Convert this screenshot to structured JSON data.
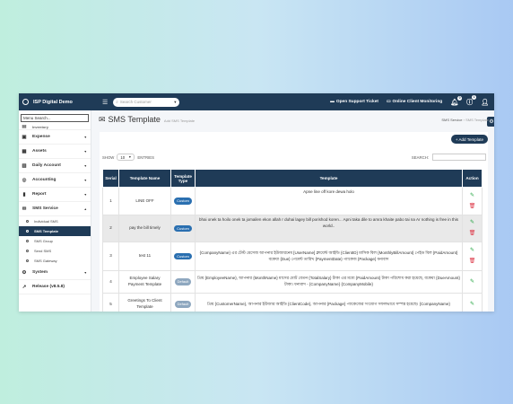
{
  "topbar": {
    "brand": "ISP Digital Demo",
    "search_placeholder": "Search Customer",
    "support_label": "Open Support Ticket",
    "monitoring_label": "Online Client Monitoring",
    "notif_count": "0",
    "info_count": "1"
  },
  "sidebar": {
    "search_placeholder": "Menu Search...",
    "top_partial": "Inventory",
    "items": [
      {
        "label": "Expense",
        "icon": "money-icon"
      },
      {
        "label": "Assets",
        "icon": "box-icon"
      },
      {
        "label": "Daily Account",
        "icon": "calendar-icon"
      },
      {
        "label": "Accounting",
        "icon": "calculator-icon"
      },
      {
        "label": "Report",
        "icon": "document-icon"
      },
      {
        "label": "SMS Service",
        "icon": "envelope-icon"
      }
    ],
    "sms_sub": [
      "Individual SMS",
      "SMS Template",
      "SMS Group",
      "Send SMS",
      "SMS Gateway"
    ],
    "system_label": "System",
    "release_label": "Release (v8.5.8)"
  },
  "header": {
    "title": "SMS Template",
    "add_link": "Add SMS Template",
    "crumb_parent": "SMS Service",
    "crumb_current": "SMS Template"
  },
  "toolbar": {
    "add_button": "+ Add Template",
    "show_label": "SHOW",
    "entries_value": "10",
    "entries_label": "ENTRIES",
    "search_label": "SEARCH:"
  },
  "table": {
    "headers": [
      "Serial",
      "Template Name",
      "Template Type",
      "Template",
      "Action"
    ],
    "rows": [
      {
        "serial": "1",
        "name": "LINE OFF",
        "type": "Custom",
        "template": "Apne line off kore dewa holo"
      },
      {
        "serial": "2",
        "name": "pay the bill timely",
        "type": "Custom",
        "template": "bhai onek ta hoilo onek ta jomailen ekon allah r duhai lagey bill porishod koren... Apni taka dile to amra khaite pabo tai na Ar nothing is free in this world.."
      },
      {
        "serial": "3",
        "name": "test 11",
        "type": "Custom",
        "template": "{CompanyName} এর টেস্ট মেসেজ আপনার ইউজারনেম [UserName] ক্লায়েন্ট আইডি {ClientID} মাসিক বিল {MonthlyBillAmount} পেইড বিল {PaidAmount} বকেয়া {Due} পেমেন্ট তারিখ {PaymentDate} প্যাকেজ {Package} ধন্যবাদ"
      },
      {
        "serial": "4",
        "name": "Employee Salary Payment Template",
        "type": "Default",
        "template": "প্রিয় {EmployeeName}, আপনার {MonthName} মাসের মোট বেতন {TotalSalary} টাকা এর মধ্যে {PaidAmount} টাকা পরিশোধ করা হয়েছে, বকেয়া {DueAmount} টাকা। ধন্যবাদ - {CompanyName} {CompanyMobile}"
      },
      {
        "serial": "5",
        "name": "Greetings To Client Template",
        "type": "Default",
        "template": "প্রিয় {CustomerName}, আপনার ইউজার আইডি {ClientCode}, আপনার {Package} প্যাকেজের সংযোগ সফলভাবে সম্পন্ন হয়েছে। {CompanyName}"
      }
    ]
  },
  "colors": {
    "navy": "#1f3b57",
    "custom_pill": "#2a6fb0",
    "default_pill": "#8ea7bf",
    "edit": "#28a745",
    "delete": "#dc3545"
  }
}
